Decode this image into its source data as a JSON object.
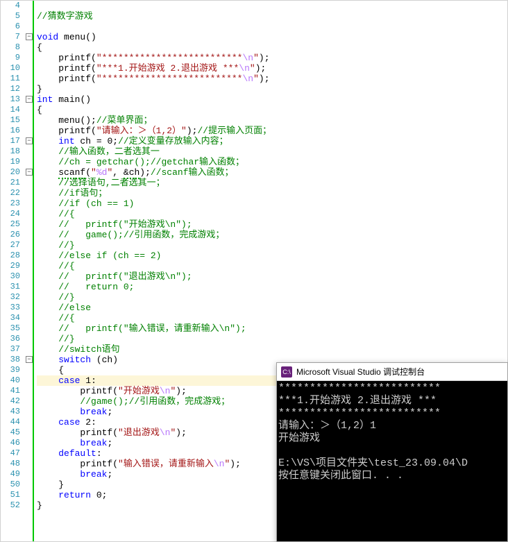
{
  "gutter": {
    "start": 4,
    "end": 52
  },
  "fold_boxes": [
    {
      "line": 7,
      "sym": "−"
    },
    {
      "line": 13,
      "sym": "−"
    },
    {
      "line": 17,
      "sym": "−"
    },
    {
      "line": 20,
      "sym": "−"
    },
    {
      "line": 38,
      "sym": "−"
    }
  ],
  "highlight_line": 40,
  "code": [
    [],
    [
      {
        "c": "c-com",
        "t": "//猜数字游戏"
      }
    ],
    [],
    [
      {
        "c": "c-kw",
        "t": "void"
      },
      {
        "c": "c-pun",
        "t": " "
      },
      {
        "c": "c-ident",
        "t": "menu"
      },
      {
        "c": "c-pun",
        "t": "()"
      }
    ],
    [
      {
        "c": "c-pun",
        "t": "{"
      }
    ],
    [
      {
        "c": "c-pun",
        "t": "    "
      },
      {
        "c": "c-ident",
        "t": "printf"
      },
      {
        "c": "c-pun",
        "t": "("
      },
      {
        "c": "c-str",
        "t": "\"**************************"
      },
      {
        "c": "c-esc",
        "t": "\\n"
      },
      {
        "c": "c-str",
        "t": "\""
      },
      {
        "c": "c-pun",
        "t": ");"
      }
    ],
    [
      {
        "c": "c-pun",
        "t": "    "
      },
      {
        "c": "c-ident",
        "t": "printf"
      },
      {
        "c": "c-pun",
        "t": "("
      },
      {
        "c": "c-str",
        "t": "\"***1.开始游戏 2.退出游戏 ***"
      },
      {
        "c": "c-esc",
        "t": "\\n"
      },
      {
        "c": "c-str",
        "t": "\""
      },
      {
        "c": "c-pun",
        "t": ");"
      }
    ],
    [
      {
        "c": "c-pun",
        "t": "    "
      },
      {
        "c": "c-ident",
        "t": "printf"
      },
      {
        "c": "c-pun",
        "t": "("
      },
      {
        "c": "c-str",
        "t": "\"**************************"
      },
      {
        "c": "c-esc",
        "t": "\\n"
      },
      {
        "c": "c-str",
        "t": "\""
      },
      {
        "c": "c-pun",
        "t": ");"
      }
    ],
    [
      {
        "c": "c-pun",
        "t": "}"
      }
    ],
    [
      {
        "c": "c-kw",
        "t": "int"
      },
      {
        "c": "c-pun",
        "t": " "
      },
      {
        "c": "c-ident",
        "t": "main"
      },
      {
        "c": "c-pun",
        "t": "()"
      }
    ],
    [
      {
        "c": "c-pun",
        "t": "{"
      }
    ],
    [
      {
        "c": "c-pun",
        "t": "    "
      },
      {
        "c": "c-ident",
        "t": "menu"
      },
      {
        "c": "c-pun",
        "t": "();"
      },
      {
        "c": "c-com",
        "t": "//菜单界面；"
      }
    ],
    [
      {
        "c": "c-pun",
        "t": "    "
      },
      {
        "c": "c-ident",
        "t": "printf"
      },
      {
        "c": "c-pun",
        "t": "("
      },
      {
        "c": "c-str",
        "t": "\"请输入：＞（1,2）\""
      },
      {
        "c": "c-pun",
        "t": ");"
      },
      {
        "c": "c-com",
        "t": "//提示输入页面；"
      }
    ],
    [
      {
        "c": "c-pun",
        "t": "    "
      },
      {
        "c": "c-kw",
        "t": "int"
      },
      {
        "c": "c-pun",
        "t": " ch = "
      },
      {
        "c": "c-num",
        "t": "0"
      },
      {
        "c": "c-pun",
        "t": ";"
      },
      {
        "c": "c-com",
        "t": "//定义变量存放输入内容；"
      }
    ],
    [
      {
        "c": "c-pun",
        "t": "    "
      },
      {
        "c": "c-com",
        "t": "//输入函数，二者选其一"
      }
    ],
    [
      {
        "c": "c-pun",
        "t": "    "
      },
      {
        "c": "c-com",
        "t": "//ch = getchar();//getchar输入函数；"
      }
    ],
    [
      {
        "c": "c-pun",
        "t": "    "
      },
      {
        "c": "c-ident c-sqg",
        "t": "scanf"
      },
      {
        "c": "c-pun",
        "t": "("
      },
      {
        "c": "c-str",
        "t": "\""
      },
      {
        "c": "c-esc",
        "t": "%d"
      },
      {
        "c": "c-str",
        "t": "\""
      },
      {
        "c": "c-pun",
        "t": ", "
      },
      {
        "c": "c-pun c-sqg",
        "t": "&ch"
      },
      {
        "c": "c-pun",
        "t": ");"
      },
      {
        "c": "c-com",
        "t": "//scanf输入函数；"
      }
    ],
    [
      {
        "c": "c-pun",
        "t": "    "
      },
      {
        "c": "c-com",
        "t": "//选择语句,二者选其一；"
      }
    ],
    [
      {
        "c": "c-pun",
        "t": "    "
      },
      {
        "c": "c-com",
        "t": "//if语句；"
      }
    ],
    [
      {
        "c": "c-pun",
        "t": "    "
      },
      {
        "c": "c-com",
        "t": "//if (ch == 1)"
      }
    ],
    [
      {
        "c": "c-pun",
        "t": "    "
      },
      {
        "c": "c-com",
        "t": "//{"
      }
    ],
    [
      {
        "c": "c-pun",
        "t": "    "
      },
      {
        "c": "c-com",
        "t": "//   printf(\"开始游戏\\n\");"
      }
    ],
    [
      {
        "c": "c-pun",
        "t": "    "
      },
      {
        "c": "c-com",
        "t": "//   game();//引用函数，完成游戏；"
      }
    ],
    [
      {
        "c": "c-pun",
        "t": "    "
      },
      {
        "c": "c-com",
        "t": "//}"
      }
    ],
    [
      {
        "c": "c-pun",
        "t": "    "
      },
      {
        "c": "c-com",
        "t": "//else if (ch == 2)"
      }
    ],
    [
      {
        "c": "c-pun",
        "t": "    "
      },
      {
        "c": "c-com",
        "t": "//{"
      }
    ],
    [
      {
        "c": "c-pun",
        "t": "    "
      },
      {
        "c": "c-com",
        "t": "//   printf(\"退出游戏\\n\");"
      }
    ],
    [
      {
        "c": "c-pun",
        "t": "    "
      },
      {
        "c": "c-com",
        "t": "//   return 0;"
      }
    ],
    [
      {
        "c": "c-pun",
        "t": "    "
      },
      {
        "c": "c-com",
        "t": "//}"
      }
    ],
    [
      {
        "c": "c-pun",
        "t": "    "
      },
      {
        "c": "c-com",
        "t": "//else"
      }
    ],
    [
      {
        "c": "c-pun",
        "t": "    "
      },
      {
        "c": "c-com",
        "t": "//{"
      }
    ],
    [
      {
        "c": "c-pun",
        "t": "    "
      },
      {
        "c": "c-com",
        "t": "//   printf(\"输入错误，请重新输入\\n\");"
      }
    ],
    [
      {
        "c": "c-pun",
        "t": "    "
      },
      {
        "c": "c-com",
        "t": "//}"
      }
    ],
    [
      {
        "c": "c-pun",
        "t": "    "
      },
      {
        "c": "c-com",
        "t": "//switch语句"
      }
    ],
    [
      {
        "c": "c-pun",
        "t": "    "
      },
      {
        "c": "c-kw",
        "t": "switch"
      },
      {
        "c": "c-pun",
        "t": " (ch)"
      }
    ],
    [
      {
        "c": "c-pun",
        "t": "    {"
      }
    ],
    [
      {
        "c": "c-pun",
        "t": "    "
      },
      {
        "c": "c-kw",
        "t": "case"
      },
      {
        "c": "c-pun",
        "t": " "
      },
      {
        "c": "c-num",
        "t": "1"
      },
      {
        "c": "c-pun",
        "t": ":"
      }
    ],
    [
      {
        "c": "c-pun",
        "t": "        "
      },
      {
        "c": "c-ident",
        "t": "printf"
      },
      {
        "c": "c-pun",
        "t": "("
      },
      {
        "c": "c-str",
        "t": "\"开始游戏"
      },
      {
        "c": "c-esc",
        "t": "\\n"
      },
      {
        "c": "c-str",
        "t": "\""
      },
      {
        "c": "c-pun",
        "t": ");"
      }
    ],
    [
      {
        "c": "c-pun",
        "t": "        "
      },
      {
        "c": "c-com",
        "t": "//game();//引用函数，完成游戏；"
      }
    ],
    [
      {
        "c": "c-pun",
        "t": "        "
      },
      {
        "c": "c-kw",
        "t": "break"
      },
      {
        "c": "c-pun",
        "t": ";"
      }
    ],
    [
      {
        "c": "c-pun",
        "t": "    "
      },
      {
        "c": "c-kw",
        "t": "case"
      },
      {
        "c": "c-pun",
        "t": " "
      },
      {
        "c": "c-num",
        "t": "2"
      },
      {
        "c": "c-pun",
        "t": ":"
      }
    ],
    [
      {
        "c": "c-pun",
        "t": "        "
      },
      {
        "c": "c-ident",
        "t": "printf"
      },
      {
        "c": "c-pun",
        "t": "("
      },
      {
        "c": "c-str",
        "t": "\"退出游戏"
      },
      {
        "c": "c-esc",
        "t": "\\n"
      },
      {
        "c": "c-str",
        "t": "\""
      },
      {
        "c": "c-pun",
        "t": ");"
      }
    ],
    [
      {
        "c": "c-pun",
        "t": "        "
      },
      {
        "c": "c-kw",
        "t": "break"
      },
      {
        "c": "c-pun",
        "t": ";"
      }
    ],
    [
      {
        "c": "c-pun",
        "t": "    "
      },
      {
        "c": "c-kw",
        "t": "default"
      },
      {
        "c": "c-pun",
        "t": ":"
      }
    ],
    [
      {
        "c": "c-pun",
        "t": "        "
      },
      {
        "c": "c-ident",
        "t": "printf"
      },
      {
        "c": "c-pun",
        "t": "("
      },
      {
        "c": "c-str",
        "t": "\"输入错误，请重新输入"
      },
      {
        "c": "c-esc",
        "t": "\\n"
      },
      {
        "c": "c-str",
        "t": "\""
      },
      {
        "c": "c-pun",
        "t": ");"
      }
    ],
    [
      {
        "c": "c-pun",
        "t": "        "
      },
      {
        "c": "c-kw",
        "t": "break"
      },
      {
        "c": "c-pun",
        "t": ";"
      }
    ],
    [
      {
        "c": "c-pun",
        "t": "    }"
      }
    ],
    [
      {
        "c": "c-pun",
        "t": "    "
      },
      {
        "c": "c-kw",
        "t": "return"
      },
      {
        "c": "c-pun",
        "t": " "
      },
      {
        "c": "c-num",
        "t": "0"
      },
      {
        "c": "c-pun",
        "t": ";"
      }
    ],
    [
      {
        "c": "c-pun",
        "t": "}"
      }
    ]
  ],
  "indent": {
    "7": 1,
    "8": 2,
    "9": 2,
    "10": 2,
    "11": 2,
    "12": 1,
    "13": 1,
    "14": 2,
    "15": 2,
    "16": 2,
    "17": 2,
    "18": 2,
    "19": 2,
    "20": 2,
    "21": 2,
    "22": 2,
    "23": 2,
    "24": 2,
    "25": 2,
    "26": 2,
    "27": 2,
    "28": 2,
    "29": 2,
    "30": 2,
    "31": 2,
    "32": 2,
    "33": 2,
    "34": 2,
    "35": 2,
    "36": 2,
    "37": 2,
    "38": 2,
    "39": 2,
    "40": 2,
    "41": 3,
    "42": 3,
    "43": 3,
    "44": 2,
    "45": 3,
    "46": 3,
    "47": 2,
    "48": 3,
    "49": 3,
    "50": 2,
    "51": 2,
    "52": 1
  },
  "console": {
    "title_icon": "C:\\",
    "title": "Microsoft Visual Studio 调试控制台",
    "lines": [
      "**************************",
      "***1.开始游戏 2.退出游戏 ***",
      "**************************",
      "请输入：＞（1,2）1",
      "开始游戏",
      "",
      "E:\\VS\\项目文件夹\\test_23.09.04\\D",
      "按任意键关闭此窗口. . ."
    ]
  }
}
